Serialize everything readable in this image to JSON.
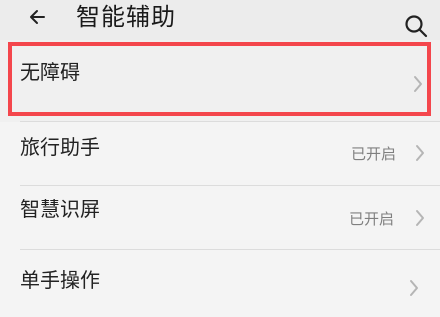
{
  "header": {
    "title": "智能辅助",
    "back_icon": "back-arrow-icon",
    "search_icon": "search-icon"
  },
  "items": [
    {
      "label": "无障碍",
      "status": "",
      "chevron_icon": "chevron-right-icon"
    },
    {
      "label": "旅行助手",
      "status": "已开启",
      "chevron_icon": "chevron-right-icon"
    },
    {
      "label": "智慧识屏",
      "status": "已开启",
      "chevron_icon": "chevron-right-icon"
    },
    {
      "label": "单手操作",
      "status": "",
      "chevron_icon": "chevron-right-icon"
    }
  ],
  "colors": {
    "background": "#e9e9e9",
    "row": "#f4f4f4",
    "highlight": "#f4464c",
    "status_text": "#7f7f7f",
    "title_text": "#1a1a1a"
  }
}
